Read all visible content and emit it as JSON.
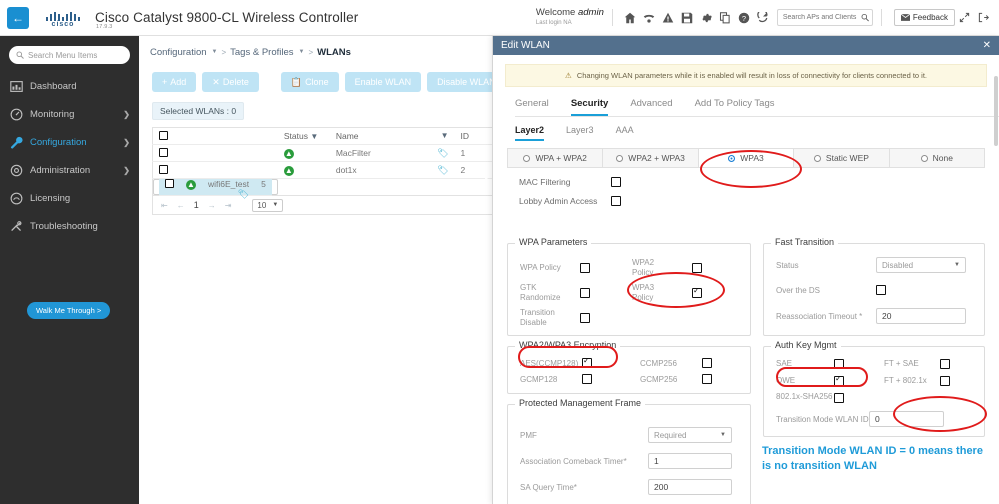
{
  "topbar": {
    "back_icon": "back-arrow-icon",
    "brand": "cisco",
    "app_title": "Cisco Catalyst 9800-CL Wireless Controller",
    "version": "17.9.3",
    "welcome_prefix": "Welcome ",
    "welcome_user": "admin",
    "last_login": "Last login NA",
    "icons": [
      "home-icon",
      "access-point-icon",
      "alert-icon",
      "save-icon",
      "gear-icon",
      "copy-icon",
      "help-icon",
      "refresh-icon"
    ],
    "search_placeholder": "Search APs and Clients",
    "feedback_label": "Feedback",
    "expand_icon": "expand-icon",
    "logout_icon": "logout-icon"
  },
  "sidebar": {
    "search_placeholder": "Search Menu Items",
    "items": [
      {
        "label": "Dashboard",
        "icon": "dashboard-icon",
        "expandable": false,
        "active": false
      },
      {
        "label": "Monitoring",
        "icon": "monitoring-icon",
        "expandable": true,
        "active": false
      },
      {
        "label": "Configuration",
        "icon": "wrench-icon",
        "expandable": true,
        "active": true
      },
      {
        "label": "Administration",
        "icon": "gear-icon",
        "expandable": true,
        "active": false
      },
      {
        "label": "Licensing",
        "icon": "licensing-icon",
        "expandable": false,
        "active": false
      },
      {
        "label": "Troubleshooting",
        "icon": "troubleshooting-icon",
        "expandable": false,
        "active": false
      }
    ],
    "walk_me_through": "Walk Me Through >"
  },
  "breadcrumb": {
    "item1": "Configuration",
    "item2": "Tags & Profiles",
    "current": "WLANs",
    "sep": ">"
  },
  "toolbar": {
    "add": "Add",
    "delete": "Delete",
    "clone": "Clone",
    "enable": "Enable WLAN",
    "disable": "Disable WLAN"
  },
  "wlan_list": {
    "selected_label": "Selected WLANs : 0",
    "columns": [
      "Status",
      "Name",
      "ID"
    ],
    "rows": [
      {
        "status": "enabled",
        "name": "MacFilter",
        "id": "1",
        "selected": false
      },
      {
        "status": "enabled",
        "name": "dot1x",
        "id": "2",
        "selected": false
      },
      {
        "status": "enabled",
        "name": "wifi6E_test",
        "id": "5",
        "selected": true
      }
    ],
    "pagination": {
      "page": "1",
      "page_size": "10"
    }
  },
  "panel": {
    "title": "Edit WLAN",
    "close_icon": "close-icon",
    "warning": "Changing WLAN parameters while it is enabled will result in loss of connectivity for clients connected to it.",
    "tabs": [
      {
        "label": "General",
        "active": false
      },
      {
        "label": "Security",
        "active": true
      },
      {
        "label": "Advanced",
        "active": false
      },
      {
        "label": "Add To Policy Tags",
        "active": false
      }
    ],
    "subtabs": [
      {
        "label": "Layer2",
        "active": true
      },
      {
        "label": "Layer3",
        "active": false
      },
      {
        "label": "AAA",
        "active": false
      }
    ],
    "security_modes": [
      {
        "label": "WPA + WPA2",
        "selected": false
      },
      {
        "label": "WPA2 + WPA3",
        "selected": false
      },
      {
        "label": "WPA3",
        "selected": true
      },
      {
        "label": "Static WEP",
        "selected": false
      },
      {
        "label": "None",
        "selected": false
      }
    ],
    "mac_filtering": {
      "label": "MAC Filtering",
      "checked": false
    },
    "lobby_admin": {
      "label": "Lobby Admin Access",
      "checked": false
    },
    "wpa_parameters": {
      "legend": "WPA Parameters",
      "wpa_policy": {
        "label": "WPA Policy",
        "checked": false
      },
      "gtk_randomize": {
        "label": "GTK Randomize",
        "checked": false
      },
      "transition_disable": {
        "label": "Transition Disable",
        "checked": false
      },
      "wpa2_policy": {
        "label": "WPA2 Policy",
        "checked": false
      },
      "wpa3_policy": {
        "label": "WPA3 Policy",
        "checked": true
      }
    },
    "fast_transition": {
      "legend": "Fast Transition",
      "status_label": "Status",
      "status_value": "Disabled",
      "over_ds_label": "Over the DS",
      "over_ds_checked": false,
      "reassoc_label": "Reassociation Timeout *",
      "reassoc_value": "20"
    },
    "encryption": {
      "legend": "WPA2/WPA3 Encryption",
      "aes_ccmp128": {
        "label": "AES(CCMP128)",
        "checked": true
      },
      "gcmp128": {
        "label": "GCMP128",
        "checked": false
      },
      "ccmp256": {
        "label": "CCMP256",
        "checked": false
      },
      "gcmp256": {
        "label": "GCMP256",
        "checked": false
      }
    },
    "auth_key_mgmt": {
      "legend": "Auth Key Mgmt",
      "sae": {
        "label": "SAE",
        "checked": false
      },
      "owe": {
        "label": "OWE",
        "checked": true
      },
      "dot1x_sha256": {
        "label": "802.1x-SHA256",
        "checked": false
      },
      "ft_sae": {
        "label": "FT + SAE",
        "checked": false
      },
      "ft_dot1x": {
        "label": "FT + 802.1x",
        "checked": false
      },
      "transition_id_label": "Transition Mode WLAN ID",
      "transition_id_value": "0"
    },
    "pmf": {
      "legend": "Protected Management Frame",
      "pmf_label": "PMF",
      "pmf_value": "Required",
      "comeback_label": "Association Comeback Timer*",
      "comeback_value": "1",
      "sa_query_label": "SA Query Time*",
      "sa_query_value": "200"
    }
  },
  "annotation": {
    "text": "Transition Mode WLAN ID = 0 means there is no transition WLAN",
    "color": "#1f9bd8"
  },
  "colors": {
    "panel_header": "#53708d",
    "accent": "#1a9fd8",
    "highlight_row": "#cfe9f2",
    "annotation_red": "#e01b1b",
    "sidebar_bg": "#2e2e2e"
  }
}
